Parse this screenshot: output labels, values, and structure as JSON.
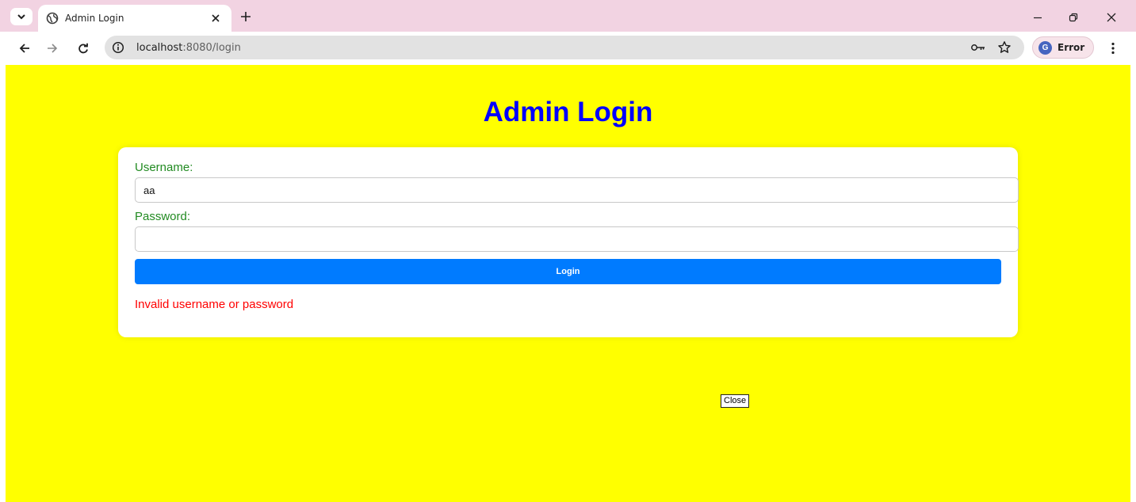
{
  "browser": {
    "tab": {
      "title": "Admin Login"
    },
    "new_tab_symbol": "+",
    "address_bar": {
      "host": "localhost",
      "path": ":8080/login"
    },
    "profile": {
      "initial": "G",
      "label": "Error"
    },
    "accent": "#f2d3e2"
  },
  "page": {
    "title": "Admin Login",
    "background_color": "#ffff00",
    "title_color": "#0000ff",
    "form": {
      "username_label": "Username:",
      "username_value": "aa",
      "password_label": "Password:",
      "password_value": "",
      "login_label": "Login",
      "login_color": "#007bff",
      "label_color": "#228b22"
    },
    "error_message": "Invalid username or password",
    "close_label": "Close"
  },
  "icons": {
    "tab_list": "chevron-down-icon",
    "tab_favicon": "globe-icon",
    "tab_close": "close-icon",
    "back": "arrow-left-icon",
    "forward": "arrow-right-icon",
    "reload": "reload-icon",
    "site_info": "info-icon",
    "password_key": "key-icon",
    "bookmark": "star-icon",
    "menu": "kebab-menu-icon",
    "minimize": "minimize-icon",
    "restore": "restore-icon",
    "window_close": "close-icon"
  }
}
